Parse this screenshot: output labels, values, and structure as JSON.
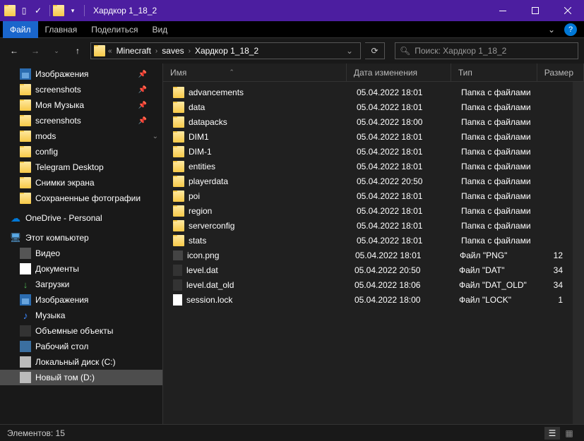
{
  "window": {
    "title": "Хардкор 1_18_2"
  },
  "menu": {
    "file": "Файл",
    "home": "Главная",
    "share": "Поделиться",
    "view": "Вид"
  },
  "breadcrumbs": [
    "Minecraft",
    "saves",
    "Хардкор 1_18_2"
  ],
  "search_placeholder": "Поиск: Хардкор 1_18_2",
  "columns": {
    "name": "Имя",
    "date": "Дата изменения",
    "type": "Тип",
    "size": "Размер"
  },
  "sidebar": {
    "quick": [
      {
        "label": "Изображения",
        "icon": "pics",
        "pinned": true
      },
      {
        "label": "screenshots",
        "icon": "folder",
        "pinned": true
      },
      {
        "label": "Моя Музыка",
        "icon": "music-folder",
        "pinned": true
      },
      {
        "label": "screenshots",
        "icon": "folder",
        "pinned": true
      },
      {
        "label": "mods",
        "icon": "folder",
        "chev": true
      },
      {
        "label": "config",
        "icon": "folder"
      },
      {
        "label": "Telegram Desktop",
        "icon": "folder"
      },
      {
        "label": "Снимки экрана",
        "icon": "folder"
      },
      {
        "label": "Сохраненные фотографии",
        "icon": "folder"
      }
    ],
    "onedrive": "OneDrive - Personal",
    "this_pc": "Этот компьютер",
    "pc_items": [
      {
        "label": "Видео",
        "icon": "video"
      },
      {
        "label": "Документы",
        "icon": "doc"
      },
      {
        "label": "Загрузки",
        "icon": "dl"
      },
      {
        "label": "Изображения",
        "icon": "pics"
      },
      {
        "label": "Музыка",
        "icon": "music"
      },
      {
        "label": "Объемные объекты",
        "icon": "3d"
      },
      {
        "label": "Рабочий стол",
        "icon": "desk"
      },
      {
        "label": "Локальный диск (C:)",
        "icon": "disk"
      },
      {
        "label": "Новый том (D:)",
        "icon": "disk",
        "selected": true
      }
    ]
  },
  "files": [
    {
      "name": "advancements",
      "date": "05.04.2022 18:01",
      "type": "Папка с файлами",
      "size": "",
      "icon": "folder"
    },
    {
      "name": "data",
      "date": "05.04.2022 18:01",
      "type": "Папка с файлами",
      "size": "",
      "icon": "folder"
    },
    {
      "name": "datapacks",
      "date": "05.04.2022 18:00",
      "type": "Папка с файлами",
      "size": "",
      "icon": "folder"
    },
    {
      "name": "DIM1",
      "date": "05.04.2022 18:01",
      "type": "Папка с файлами",
      "size": "",
      "icon": "folder"
    },
    {
      "name": "DIM-1",
      "date": "05.04.2022 18:01",
      "type": "Папка с файлами",
      "size": "",
      "icon": "folder"
    },
    {
      "name": "entities",
      "date": "05.04.2022 18:01",
      "type": "Папка с файлами",
      "size": "",
      "icon": "folder"
    },
    {
      "name": "playerdata",
      "date": "05.04.2022 20:50",
      "type": "Папка с файлами",
      "size": "",
      "icon": "folder"
    },
    {
      "name": "poi",
      "date": "05.04.2022 18:01",
      "type": "Папка с файлами",
      "size": "",
      "icon": "folder"
    },
    {
      "name": "region",
      "date": "05.04.2022 18:01",
      "type": "Папка с файлами",
      "size": "",
      "icon": "folder"
    },
    {
      "name": "serverconfig",
      "date": "05.04.2022 18:01",
      "type": "Папка с файлами",
      "size": "",
      "icon": "folder"
    },
    {
      "name": "stats",
      "date": "05.04.2022 18:01",
      "type": "Папка с файлами",
      "size": "",
      "icon": "folder"
    },
    {
      "name": "icon.png",
      "date": "05.04.2022 18:01",
      "type": "Файл \"PNG\"",
      "size": "12",
      "icon": "png"
    },
    {
      "name": "level.dat",
      "date": "05.04.2022 20:50",
      "type": "Файл \"DAT\"",
      "size": "34",
      "icon": "dat"
    },
    {
      "name": "level.dat_old",
      "date": "05.04.2022 18:06",
      "type": "Файл \"DAT_OLD\"",
      "size": "34",
      "icon": "dat"
    },
    {
      "name": "session.lock",
      "date": "05.04.2022 18:00",
      "type": "Файл \"LOCK\"",
      "size": "1",
      "icon": "file"
    }
  ],
  "status": {
    "count_label": "Элементов:",
    "count": "15"
  }
}
